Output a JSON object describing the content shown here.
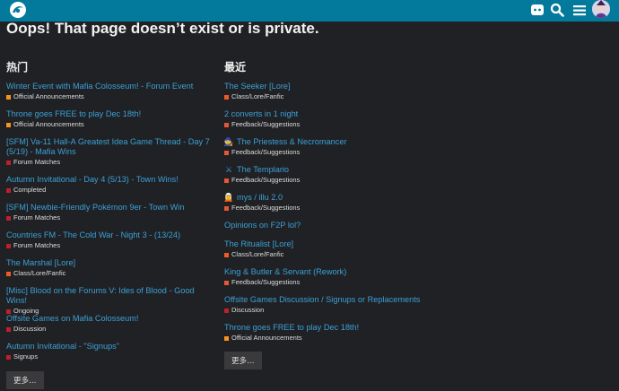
{
  "header": {
    "logo_icon": "forum-logo-icon",
    "icons": [
      "discord-icon",
      "search-icon",
      "hamburger-menu-icon",
      "user-avatar"
    ]
  },
  "page_title": "Oops! That page doesn’t exist or is private.",
  "colors": {
    "header_bg": "#037a9c",
    "page_bg": "#202124",
    "link": "#3ba0d6",
    "cat_official": "#f7941d",
    "cat_forum_matches": "#bf1e2e",
    "cat_completed": "#bf1e2e",
    "cat_class_lore": "#f15a24",
    "cat_feedback": "#e45735",
    "cat_discussion": "#bf1e2e",
    "cat_ongoing": "#bf1e2e",
    "cat_signups": "#bf1e2e"
  },
  "left": {
    "heading": "热门",
    "topics": [
      {
        "title": "Winter Event with Mafia Colosseum! - Forum Event",
        "category": "Official Announcements",
        "color": "#f7941d"
      },
      {
        "title": "Throne goes FREE to play Dec 18th!",
        "category": "Official Announcements",
        "color": "#f7941d"
      },
      {
        "title": "[SFM] Va-11 Hall-A Greatest Idea Game Thread - Day 7",
        "title2": "(5/19) - Mafia Wins",
        "category": "Forum Matches",
        "color": "#bf1e2e"
      },
      {
        "title": "Autumn Invitational - Day 4 (5/13) - Town Wins!",
        "category": "Completed",
        "color": "#bf1e2e"
      },
      {
        "title": "[SFM] Newbie-Friendly Pokémon 9er - Town Win",
        "category": "Forum Matches",
        "color": "#bf1e2e"
      },
      {
        "title": "Countries FM - The Cold War - Night 3 - (13/24)",
        "category": "Forum Matches",
        "color": "#bf1e2e"
      },
      {
        "title": "The Marshal [Lore]",
        "category": "Class/Lore/Fanfic",
        "color": "#f15a24"
      },
      {
        "title": "[Misc] Blood on the Forums V: Ides of Blood - Good Wins!",
        "category": "Ongoing",
        "color": "#bf1e2e"
      },
      {
        "title": "Offsite Games on Mafia Colosseum!",
        "category": "Discussion",
        "color": "#bf1e2e"
      },
      {
        "title": "Autumn Invitational - \"Signups\"",
        "category": "Signups",
        "color": "#bf1e2e"
      }
    ],
    "more_label": "更多…"
  },
  "right": {
    "heading": "最近",
    "topics": [
      {
        "title": "The Seeker [Lore]",
        "category": "Class/Lore/Fanfic",
        "color": "#f15a24",
        "emoji": ""
      },
      {
        "title": "2 converts in 1 night",
        "category": "Feedback/Suggestions",
        "color": "#e45735",
        "emoji": ""
      },
      {
        "title": "The Priestess & Necromancer",
        "category": "Feedback/Suggestions",
        "color": "#e45735",
        "emoji": "🧙"
      },
      {
        "title": "The Templario",
        "category": "Feedback/Suggestions",
        "color": "#e45735",
        "emoji": "⚔"
      },
      {
        "title": "mys / illu 2.0",
        "category": "Feedback/Suggestions",
        "color": "#e45735",
        "emoji": "🧝"
      },
      {
        "title": "Opinions on F2P lol?",
        "category": "",
        "color": "",
        "emoji": ""
      },
      {
        "title": "The Ritualist [Lore]",
        "category": "Class/Lore/Fanfic",
        "color": "#f15a24",
        "emoji": ""
      },
      {
        "title": "King & Butler & Servant (Rework)",
        "category": "Feedback/Suggestions",
        "color": "#e45735",
        "emoji": ""
      },
      {
        "title": "Offsite Games Discussion / Signups or Replacements",
        "category": "Discussion",
        "color": "#bf1e2e",
        "emoji": ""
      },
      {
        "title": "Throne goes FREE to play Dec 18th!",
        "category": "Official Announcements",
        "color": "#f7941d",
        "emoji": ""
      }
    ],
    "more_label": "更多…"
  }
}
